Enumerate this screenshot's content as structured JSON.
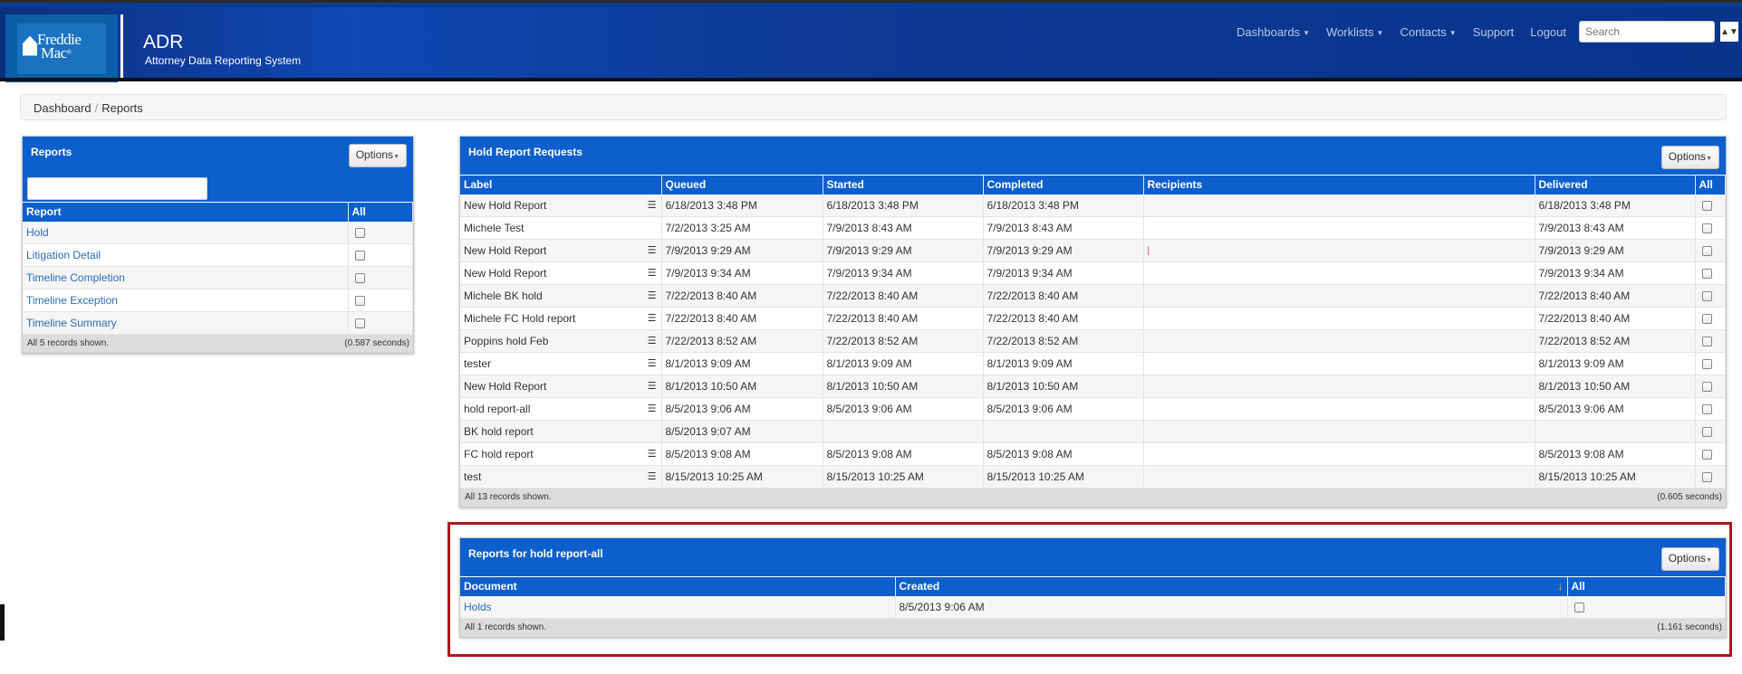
{
  "header": {
    "logo_line1": "Freddie",
    "logo_line2": "Mac",
    "app_title": "ADR",
    "app_subtitle": "Attorney Data Reporting System",
    "nav": [
      {
        "label": "Dashboards",
        "dropdown": true
      },
      {
        "label": "Worklists",
        "dropdown": true
      },
      {
        "label": "Contacts",
        "dropdown": true
      },
      {
        "label": "Support",
        "dropdown": false
      },
      {
        "label": "Logout",
        "dropdown": false
      }
    ],
    "search_placeholder": "Search"
  },
  "breadcrumb": {
    "items": [
      "Dashboard",
      "Reports"
    ],
    "separator": "/"
  },
  "reports_panel": {
    "title": "Reports",
    "options_label": "Options",
    "filter_value": "",
    "columns": [
      "Report",
      "All"
    ],
    "rows": [
      "Hold",
      "Litigation Detail",
      "Timeline Completion",
      "Timeline Exception",
      "Timeline Summary"
    ],
    "footer_left": "All 5 records shown.",
    "footer_right": "(0.587 seconds)"
  },
  "hold_panel": {
    "title": "Hold Report Requests",
    "options_label": "Options",
    "columns": [
      "Label",
      "Queued",
      "Started",
      "Completed",
      "Recipients",
      "Delivered",
      "All"
    ],
    "rows": [
      {
        "label": "New Hold Report",
        "icon": true,
        "queued": "6/18/2013 3:48 PM",
        "started": "6/18/2013 3:48 PM",
        "completed": "6/18/2013 3:48 PM",
        "recipients": "",
        "delivered": "6/18/2013 3:48 PM"
      },
      {
        "label": "Michele Test",
        "icon": false,
        "queued": "7/2/2013 3:25 AM",
        "started": "7/9/2013 8:43 AM",
        "completed": "7/9/2013 8:43 AM",
        "recipients": "",
        "delivered": "7/9/2013 8:43 AM"
      },
      {
        "label": "New Hold Report",
        "icon": true,
        "queued": "7/9/2013 9:29 AM",
        "started": "7/9/2013 9:29 AM",
        "completed": "7/9/2013 9:29 AM",
        "recipients": "|",
        "delivered": "7/9/2013 9:29 AM"
      },
      {
        "label": "New Hold Report",
        "icon": true,
        "queued": "7/9/2013 9:34 AM",
        "started": "7/9/2013 9:34 AM",
        "completed": "7/9/2013 9:34 AM",
        "recipients": "",
        "delivered": "7/9/2013 9:34 AM"
      },
      {
        "label": "Michele BK hold",
        "icon": true,
        "queued": "7/22/2013 8:40 AM",
        "started": "7/22/2013 8:40 AM",
        "completed": "7/22/2013 8:40 AM",
        "recipients": "",
        "delivered": "7/22/2013 8:40 AM"
      },
      {
        "label": "Michele FC Hold report",
        "icon": true,
        "queued": "7/22/2013 8:40 AM",
        "started": "7/22/2013 8:40 AM",
        "completed": "7/22/2013 8:40 AM",
        "recipients": "",
        "delivered": "7/22/2013 8:40 AM"
      },
      {
        "label": "Poppins hold Feb",
        "icon": true,
        "queued": "7/22/2013 8:52 AM",
        "started": "7/22/2013 8:52 AM",
        "completed": "7/22/2013 8:52 AM",
        "recipients": "",
        "delivered": "7/22/2013 8:52 AM"
      },
      {
        "label": "tester",
        "icon": true,
        "queued": "8/1/2013 9:09 AM",
        "started": "8/1/2013 9:09 AM",
        "completed": "8/1/2013 9:09 AM",
        "recipients": "",
        "delivered": "8/1/2013 9:09 AM"
      },
      {
        "label": "New Hold Report",
        "icon": true,
        "queued": "8/1/2013 10:50 AM",
        "started": "8/1/2013 10:50 AM",
        "completed": "8/1/2013 10:50 AM",
        "recipients": "",
        "delivered": "8/1/2013 10:50 AM"
      },
      {
        "label": "hold report-all",
        "icon": true,
        "queued": "8/5/2013 9:06 AM",
        "started": "8/5/2013 9:06 AM",
        "completed": "8/5/2013 9:06 AM",
        "recipients": "",
        "delivered": "8/5/2013 9:06 AM"
      },
      {
        "label": "BK hold report",
        "icon": false,
        "queued": "8/5/2013 9:07 AM",
        "started": "",
        "completed": "",
        "recipients": "",
        "delivered": ""
      },
      {
        "label": "FC hold report",
        "icon": true,
        "queued": "8/5/2013 9:08 AM",
        "started": "8/5/2013 9:08 AM",
        "completed": "8/5/2013 9:08 AM",
        "recipients": "",
        "delivered": "8/5/2013 9:08 AM"
      },
      {
        "label": "test",
        "icon": true,
        "queued": "8/15/2013 10:25 AM",
        "started": "8/15/2013 10:25 AM",
        "completed": "8/15/2013 10:25 AM",
        "recipients": "",
        "delivered": "8/15/2013 10:25 AM"
      }
    ],
    "footer_left": "All 13 records shown.",
    "footer_right": "(0.605 seconds)"
  },
  "docs_panel": {
    "title": "Reports for hold report-all",
    "options_label": "Options",
    "columns": [
      "Document",
      "Created",
      "All"
    ],
    "sort_indicator": "↓",
    "rows": [
      {
        "document": "Holds",
        "created": "8/5/2013 9:06 AM"
      }
    ],
    "footer_left": "All 1 records shown.",
    "footer_right": "(1.161 seconds)"
  },
  "colors": {
    "navy": "#0a3d91",
    "panel_blue": "#0c5fcd",
    "link": "#2a6db7",
    "highlight": "#b0171c"
  },
  "icons": {
    "row_action": "list-icon",
    "dropdown": "caret-down-icon"
  }
}
